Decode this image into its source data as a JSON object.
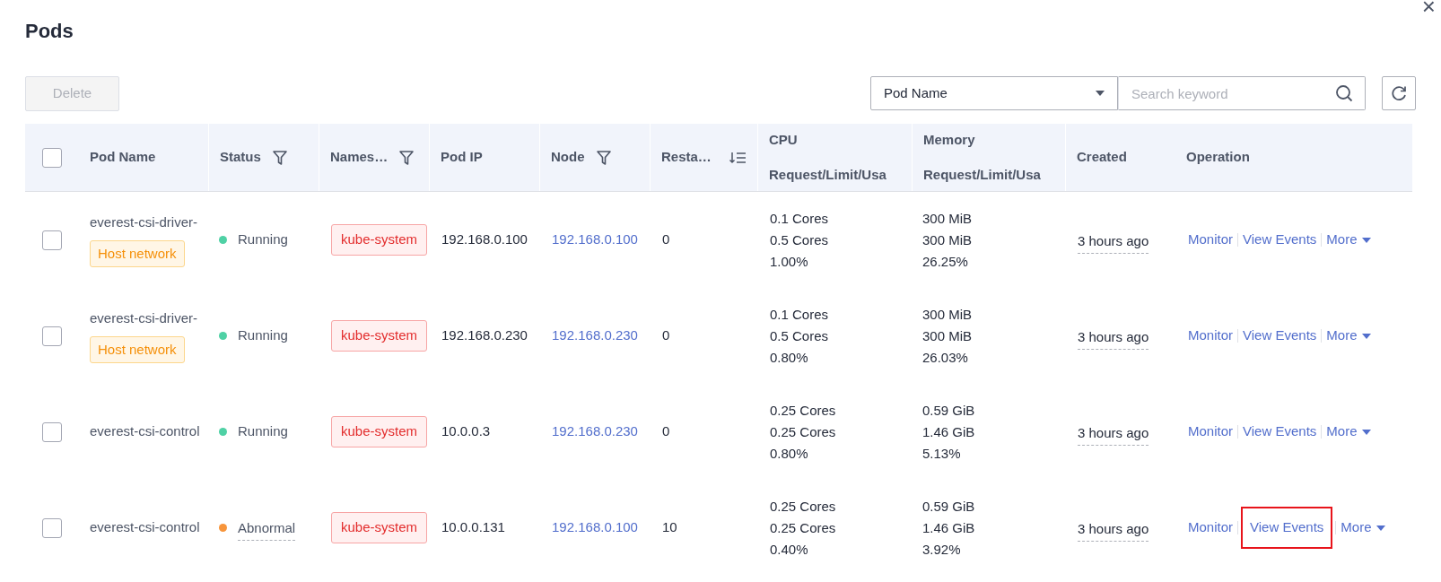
{
  "dialog": {
    "title": "Pods",
    "close": "×"
  },
  "toolbar": {
    "delete_button": {
      "label": "Delete",
      "disabled": true
    },
    "search": {
      "field_select": "Pod Name",
      "placeholder": "Search keyword"
    }
  },
  "table": {
    "select_all": {
      "checked": false
    },
    "columns": [
      {
        "label": "Pod Name",
        "kind": "plain"
      },
      {
        "label": "Status",
        "kind": "filter"
      },
      {
        "label": "Names…",
        "kind": "filter"
      },
      {
        "label": "Pod IP",
        "kind": "plain"
      },
      {
        "label": "Node",
        "kind": "filter"
      },
      {
        "label": "Resta…",
        "kind": "sort"
      },
      {
        "label": "CPU",
        "sublabel": "Request/Limit/Usa",
        "kind": "plain"
      },
      {
        "label": "Memory",
        "sublabel": "Request/Limit/Usa",
        "kind": "plain"
      },
      {
        "label": "Created",
        "kind": "plain"
      },
      {
        "label": "Operation",
        "kind": "plain"
      }
    ],
    "rows": [
      {
        "checked": false,
        "pod_name": "everest-csi-driver-",
        "tag": "Host network",
        "status": {
          "label": "Running",
          "color": "#4fd1a5",
          "kind": "normal"
        },
        "namespace": "kube-system",
        "pod_ip": "192.168.0.100",
        "node": "192.168.0.100",
        "restarts": "0",
        "cpu": [
          "0.1 Cores",
          "0.5 Cores",
          "1.00%"
        ],
        "memory": [
          "300 MiB",
          "300 MiB",
          "26.25%"
        ],
        "created": "3 hours ago",
        "operations": [
          {
            "label": "Monitor",
            "marked": false
          },
          {
            "label": "View Events",
            "marked": false
          },
          {
            "label": "More",
            "marked": false,
            "kind": "dropdown"
          }
        ]
      },
      {
        "checked": false,
        "pod_name": "everest-csi-driver-",
        "tag": "Host network",
        "status": {
          "label": "Running",
          "color": "#4fd1a5",
          "kind": "normal"
        },
        "namespace": "kube-system",
        "pod_ip": "192.168.0.230",
        "node": "192.168.0.230",
        "restarts": "0",
        "cpu": [
          "0.1 Cores",
          "0.5 Cores",
          "0.80%"
        ],
        "memory": [
          "300 MiB",
          "300 MiB",
          "26.03%"
        ],
        "created": "3 hours ago",
        "operations": [
          {
            "label": "Monitor",
            "marked": false
          },
          {
            "label": "View Events",
            "marked": false
          },
          {
            "label": "More",
            "marked": false,
            "kind": "dropdown"
          }
        ]
      },
      {
        "checked": false,
        "pod_name": "everest-csi-control",
        "status": {
          "label": "Running",
          "color": "#4fd1a5",
          "kind": "normal"
        },
        "namespace": "kube-system",
        "pod_ip": "10.0.0.3",
        "node": "192.168.0.230",
        "restarts": "0",
        "cpu": [
          "0.25 Cores",
          "0.25 Cores",
          "0.80%"
        ],
        "memory": [
          "0.59 GiB",
          "1.46 GiB",
          "5.13%"
        ],
        "created": "3 hours ago",
        "operations": [
          {
            "label": "Monitor",
            "marked": false
          },
          {
            "label": "View Events",
            "marked": false
          },
          {
            "label": "More",
            "marked": false,
            "kind": "dropdown"
          }
        ]
      },
      {
        "checked": false,
        "pod_name": "everest-csi-control",
        "status": {
          "label": "Abnormal",
          "color": "#f7953b",
          "kind": "abnormal"
        },
        "namespace": "kube-system",
        "pod_ip": "10.0.0.131",
        "node": "192.168.0.100",
        "restarts": "10",
        "cpu": [
          "0.25 Cores",
          "0.25 Cores",
          "0.40%"
        ],
        "memory": [
          "0.59 GiB",
          "1.46 GiB",
          "3.92%"
        ],
        "created": "3 hours ago",
        "operations": [
          {
            "label": "Monitor",
            "marked": false
          },
          {
            "label": "View Events",
            "marked": true
          },
          {
            "label": "More",
            "marked": false,
            "kind": "dropdown"
          }
        ]
      }
    ]
  }
}
